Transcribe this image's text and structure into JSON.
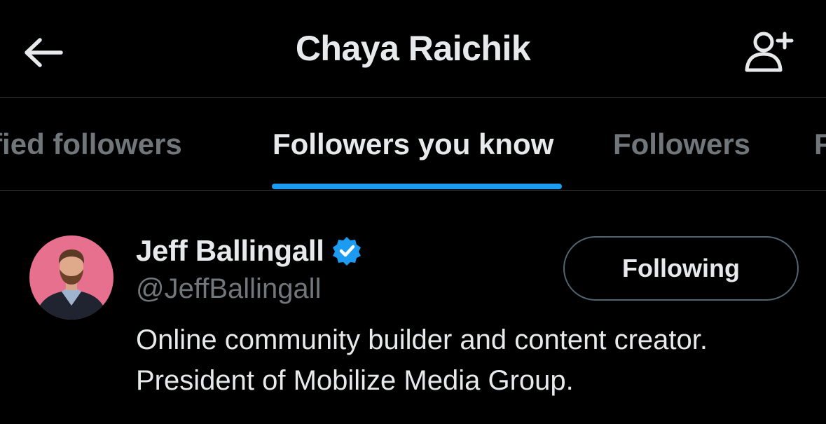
{
  "header": {
    "title": "Chaya Raichik",
    "back_icon": "arrow-left-icon",
    "add_icon": "person-add-icon"
  },
  "tabs": [
    {
      "label": "Verified followers",
      "active": false
    },
    {
      "label": "Followers you know",
      "active": true
    },
    {
      "label": "Followers",
      "active": false
    },
    {
      "label": "Following",
      "active": false
    }
  ],
  "user": {
    "name": "Jeff Ballingall",
    "handle": "@JeffBallingall",
    "verified": true,
    "follow_button": "Following",
    "bio_lines": [
      "Online community builder and content creator.",
      "President of Mobilize Media Group."
    ]
  },
  "colors": {
    "background": "#000000",
    "accent": "#1d9bf0",
    "text_primary": "#e7e9ea",
    "text_secondary": "#71767b",
    "avatar_bg": "#e8708f"
  }
}
